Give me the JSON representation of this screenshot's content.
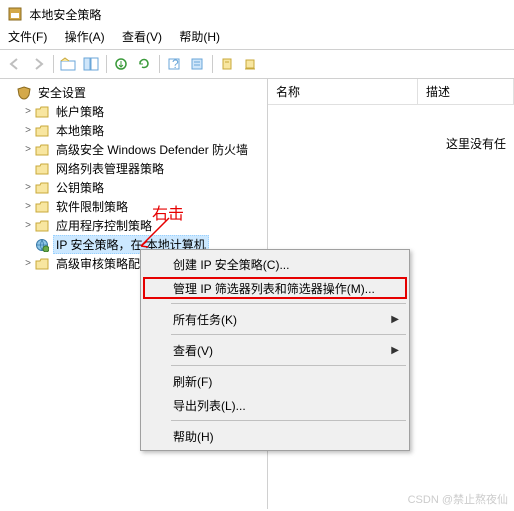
{
  "window": {
    "title": "本地安全策略"
  },
  "menubar": {
    "file": "文件(F)",
    "action": "操作(A)",
    "view": "查看(V)",
    "help": "帮助(H)"
  },
  "toolbar_icons": [
    "back",
    "forward",
    "up",
    "show",
    "help",
    "refresh",
    "export",
    "props",
    "sep",
    "opt1",
    "opt2"
  ],
  "tree": {
    "root": "安全设置",
    "items": [
      {
        "label": "帐户策略",
        "type": "folder",
        "twisty": ">"
      },
      {
        "label": "本地策略",
        "type": "folder",
        "twisty": ">"
      },
      {
        "label": "高级安全 Windows Defender 防火墙",
        "type": "folder",
        "twisty": ">"
      },
      {
        "label": "网络列表管理器策略",
        "type": "folder",
        "twisty": ""
      },
      {
        "label": "公钥策略",
        "type": "folder",
        "twisty": ">"
      },
      {
        "label": "软件限制策略",
        "type": "folder",
        "twisty": ">"
      },
      {
        "label": "应用程序控制策略",
        "type": "folder",
        "twisty": ">"
      },
      {
        "label": "IP 安全策略，在 本地计算机",
        "type": "globe",
        "twisty": "",
        "selected": true
      },
      {
        "label": "高级审核策略配置",
        "type": "folder",
        "twisty": ">"
      }
    ]
  },
  "list": {
    "columns": {
      "name": "名称",
      "desc": "描述"
    },
    "empty_text": "这里没有任"
  },
  "annotation": {
    "text": "右击"
  },
  "context_menu": {
    "items": [
      {
        "label": "创建 IP 安全策略(C)...",
        "type": "item"
      },
      {
        "label": "管理 IP 筛选器列表和筛选器操作(M)...",
        "type": "item",
        "highlight": true
      },
      {
        "type": "sep"
      },
      {
        "label": "所有任务(K)",
        "type": "sub"
      },
      {
        "type": "sep"
      },
      {
        "label": "查看(V)",
        "type": "sub"
      },
      {
        "type": "sep"
      },
      {
        "label": "刷新(F)",
        "type": "item"
      },
      {
        "label": "导出列表(L)...",
        "type": "item"
      },
      {
        "type": "sep"
      },
      {
        "label": "帮助(H)",
        "type": "item"
      }
    ]
  },
  "watermark": "CSDN @禁止熬夜仙"
}
